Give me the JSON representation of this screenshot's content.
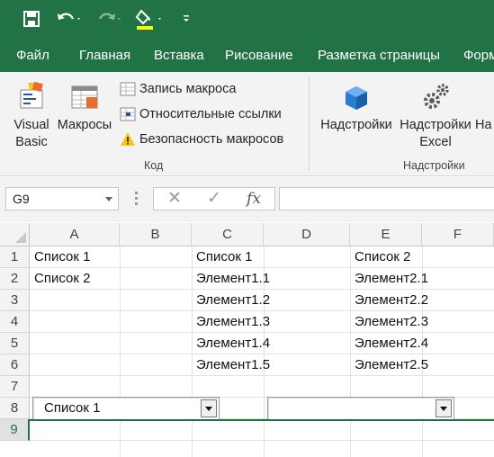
{
  "tabs": [
    "Файл",
    "Главная",
    "Вставка",
    "Рисование",
    "Разметка страницы",
    "Форм"
  ],
  "ribbon": {
    "visual_basic": [
      "Visual",
      "Basic"
    ],
    "macros": "Макросы",
    "record_macro": "Запись макроса",
    "relative_refs": "Относительные ссылки",
    "macro_security": "Безопасность макросов",
    "group_code": "Код",
    "addins": "Надстройки",
    "excel_addins": [
      "Надстройки",
      "Excel"
    ],
    "addins_cut": "На",
    "group_addins": "Надстройки"
  },
  "formula_bar": {
    "name_box": "G9",
    "cancel_glyph": "✕",
    "enter_glyph": "✓",
    "fx_label": "fx",
    "formula": ""
  },
  "columns": [
    "A",
    "B",
    "C",
    "D",
    "E",
    "F"
  ],
  "rows": [
    "1",
    "2",
    "3",
    "4",
    "5",
    "6",
    "7",
    "8",
    "9"
  ],
  "selected_row": "9",
  "cells": {
    "A1": "Список 1",
    "A2": "Список 2",
    "C1": "Список 1",
    "C2": "Элемент1.1",
    "C3": "Элемент1.2",
    "C4": "Элемент1.3",
    "C5": "Элемент1.4",
    "C6": "Элемент1.5",
    "E1": "Список 2",
    "E2": "Элемент2.1",
    "E3": "Элемент2.2",
    "E4": "Элемент2.3",
    "E5": "Элемент2.4",
    "E6": "Элемент2.5"
  },
  "combos": {
    "first_value": "Список 1",
    "second_value": ""
  },
  "colors": {
    "accent": "#217346",
    "fill_highlight": "#ffff00"
  },
  "icons": [
    "save-icon",
    "undo-icon",
    "redo-icon",
    "fill-color-icon",
    "customize-qat-icon"
  ]
}
